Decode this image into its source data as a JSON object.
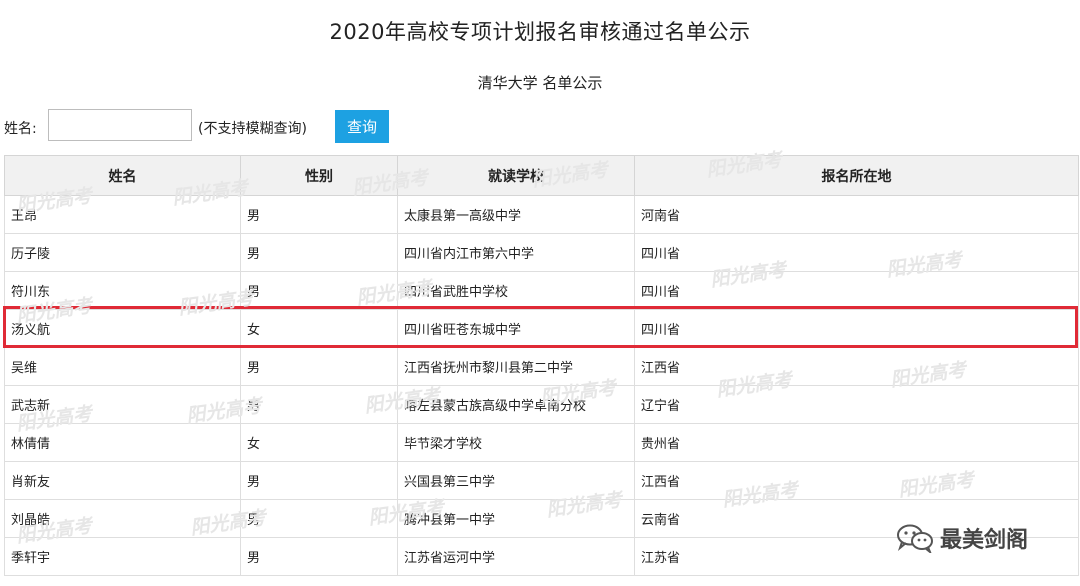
{
  "page": {
    "title": "2020年高校专项计划报名审核通过名单公示",
    "subtitle": "清华大学 名单公示"
  },
  "search": {
    "label": "姓名:",
    "value": "",
    "placeholder": "",
    "note": "(不支持模糊查询)",
    "button_label": "查询",
    "button_color": "#1da1e2"
  },
  "table": {
    "headers": [
      "姓名",
      "性别",
      "就读学校",
      "报名所在地"
    ],
    "rows": [
      [
        "王昂",
        "男",
        "太康县第一高级中学",
        "河南省"
      ],
      [
        "历子陵",
        "男",
        "四川省内江市第六中学",
        "四川省"
      ],
      [
        "符川东",
        "男",
        "四川省武胜中学校",
        "四川省"
      ],
      [
        "汤义航",
        "女",
        "四川省旺苍东城中学",
        "四川省"
      ],
      [
        "吴维",
        "男",
        "江西省抚州市黎川县第二中学",
        "江西省"
      ],
      [
        "武志新",
        "男",
        "喀左县蒙古族高级中学卓南分校",
        "辽宁省"
      ],
      [
        "林倩倩",
        "女",
        "毕节梁才学校",
        "贵州省"
      ],
      [
        "肖新友",
        "男",
        "兴国县第三中学",
        "江西省"
      ],
      [
        "刘晶皓",
        "男",
        "腾冲县第一中学",
        "云南省"
      ],
      [
        "季轩宇",
        "男",
        "江苏省运河中学",
        "江苏省"
      ]
    ],
    "highlighted_row": 3,
    "highlight_color": "#e02a36"
  },
  "watermark": {
    "text": "阳光高考"
  },
  "corner_logo": {
    "icon": "wechat-icon",
    "text": "最美剑阁"
  }
}
